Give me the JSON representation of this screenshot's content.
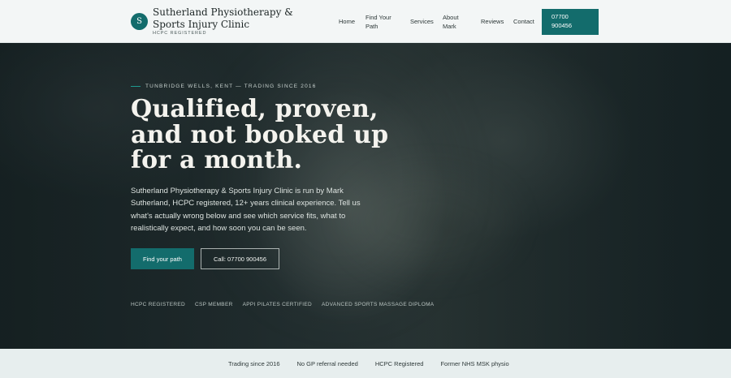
{
  "header": {
    "logo_letter": "S",
    "brand_name": "Sutherland Physiotherapy & Sports Injury Clinic",
    "brand_sub": "HCPC REGISTERED",
    "nav": {
      "home": "Home",
      "find_path": "Find Your Path",
      "services": "Services",
      "about": "About Mark",
      "reviews": "Reviews",
      "contact": "Contact"
    },
    "phone_button": "07700 900456"
  },
  "hero": {
    "eyebrow": "TUNBRIDGE WELLS, KENT — TRADING SINCE 2016",
    "headline": "Qualified, proven, and not booked up for a month.",
    "intro": "Sutherland Physiotherapy & Sports Injury Clinic is run by Mark Sutherland, HCPC registered, 12+ years clinical experience. Tell us what's actually wrong below and see which service fits, what to realistically expect, and how soon you can be seen.",
    "cta_primary": "Find your path",
    "cta_secondary": "Call: 07700 900456",
    "credentials": [
      "HCPC REGISTERED",
      "CSP MEMBER",
      "APPI PILATES CERTIFIED",
      "ADVANCED SPORTS MASSAGE DIPLOMA"
    ]
  },
  "strip": {
    "items": [
      "Trading since 2016",
      "No GP referral needed",
      "HCPC Registered",
      "Former NHS MSK physio"
    ]
  },
  "colors": {
    "accent": "#136c6c",
    "hero_dark": "#1d2a2b",
    "strip_bg": "#e7eeee"
  }
}
